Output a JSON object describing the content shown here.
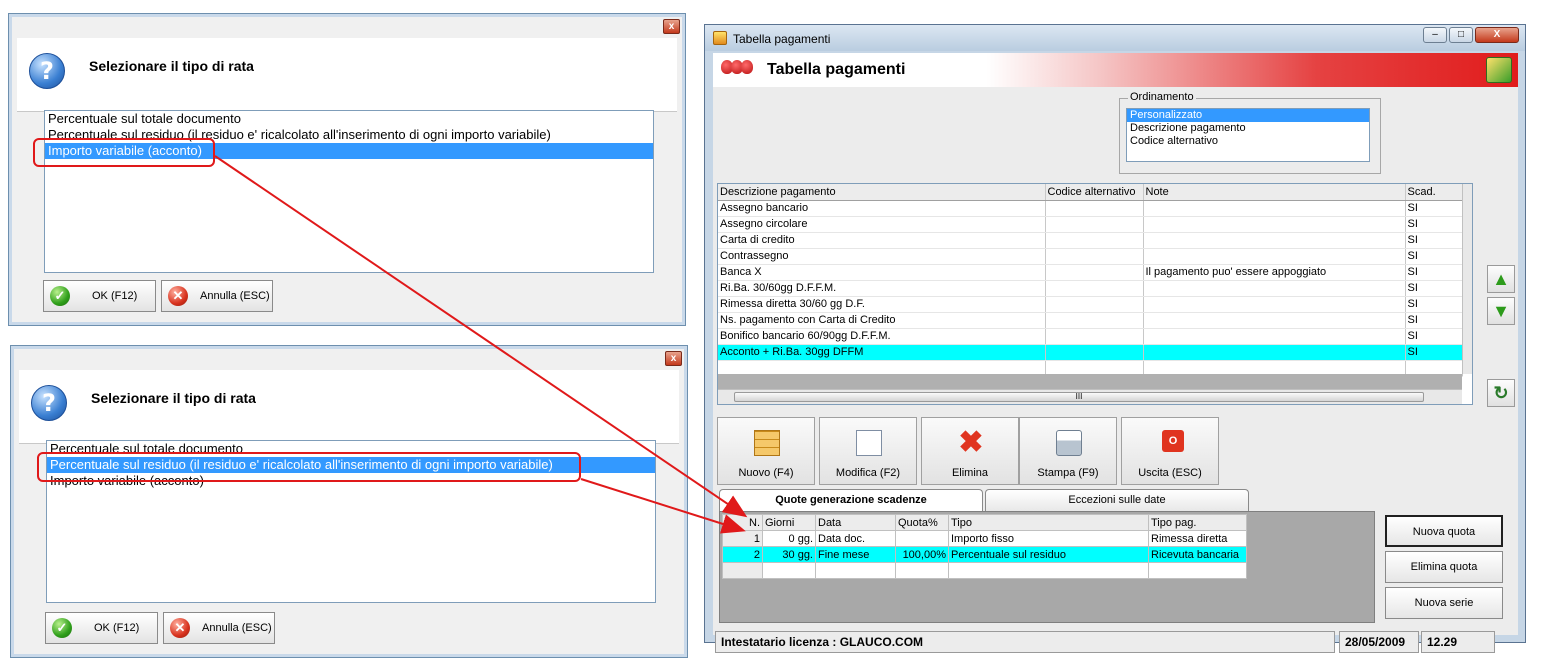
{
  "dialog_top": {
    "title": "Selezionare il tipo di rata",
    "close_glyph": "x",
    "items": [
      "Percentuale sul totale documento",
      "Percentuale sul residuo (il residuo e' ricalcolato all'inserimento di ogni importo variabile)",
      "Importo variabile (acconto)"
    ],
    "selected_index": 2,
    "ok_label": "OK (F12)",
    "cancel_label": "Annulla (ESC)"
  },
  "dialog_bottom": {
    "title": "Selezionare il tipo di rata",
    "close_glyph": "x",
    "items": [
      "Percentuale sul totale documento",
      "Percentuale sul residuo (il residuo e' ricalcolato all'inserimento di ogni importo variabile)",
      "Importo variabile (acconto)"
    ],
    "selected_index": 1,
    "ok_label": "OK (F12)",
    "cancel_label": "Annulla (ESC)"
  },
  "icons": {
    "question": "?",
    "ok": "✓",
    "cancel": "✕"
  },
  "window": {
    "title": "Tabella pagamenti",
    "banner_title": "Tabella pagamenti",
    "minimize_glyph": "–",
    "maximize_glyph": "□",
    "close_glyph": "X",
    "ordinamento": {
      "label": "Ordinamento",
      "options": [
        "Personalizzato",
        "Descrizione pagamento",
        "Codice alternativo"
      ],
      "selected": "Personalizzato"
    },
    "grid": {
      "headers": [
        "Descrizione pagamento",
        "Codice alternativo",
        "Note",
        "Scad."
      ],
      "rows": [
        [
          "Assegno bancario",
          "",
          "",
          "SI"
        ],
        [
          "Assegno circolare",
          "",
          "",
          "SI"
        ],
        [
          "Carta di credito",
          "",
          "",
          "SI"
        ],
        [
          "Contrassegno",
          "",
          "",
          "SI"
        ],
        [
          "Banca X",
          "",
          "Il pagamento puo' essere appoggiato",
          "SI"
        ],
        [
          "Ri.Ba. 30/60gg D.F.F.M.",
          "",
          "",
          "SI"
        ],
        [
          "Rimessa diretta 30/60 gg D.F.",
          "",
          "",
          "SI"
        ],
        [
          "Ns. pagamento con Carta di Credito",
          "",
          "",
          "SI"
        ],
        [
          "Bonifico bancario 60/90gg D.F.F.M.",
          "",
          "",
          "SI"
        ],
        [
          "Acconto +  Ri.Ba. 30gg DFFM",
          "",
          "",
          "SI"
        ]
      ],
      "highlighted_row": 9,
      "scroll_marker": "III"
    },
    "toolbar": {
      "new": "Nuovo (F4)",
      "edit": "Modifica (F2)",
      "delete": "Elimina",
      "print": "Stampa (F9)",
      "exit": "Uscita (ESC)"
    },
    "tabs": {
      "quote": "Quote generazione scadenze",
      "eccezioni": "Eccezioni sulle date"
    },
    "quote_grid": {
      "headers": [
        "N.",
        "Giorni",
        "Data",
        "Quota%",
        "Tipo",
        "Tipo pag."
      ],
      "rows": [
        [
          "1",
          "0 gg.",
          "Data doc.",
          "",
          "Importo fisso",
          "Rimessa diretta"
        ],
        [
          "2",
          "30 gg.",
          "Fine mese",
          "100,00%",
          "Percentuale sul residuo",
          "Ricevuta bancaria"
        ]
      ],
      "highlighted_row": 1
    },
    "side_buttons": {
      "nuova_quota": "Nuova quota",
      "elimina_quota": "Elimina quota",
      "nuova_serie": "Nuova serie"
    },
    "status": {
      "license": "Intestatario licenza : GLAUCO.COM",
      "date": "28/05/2009",
      "time": "12.29"
    }
  },
  "colors": {
    "selection_blue": "#3399ff",
    "highlight_cyan": "#00ffff",
    "annotation_red": "#e0191a"
  }
}
